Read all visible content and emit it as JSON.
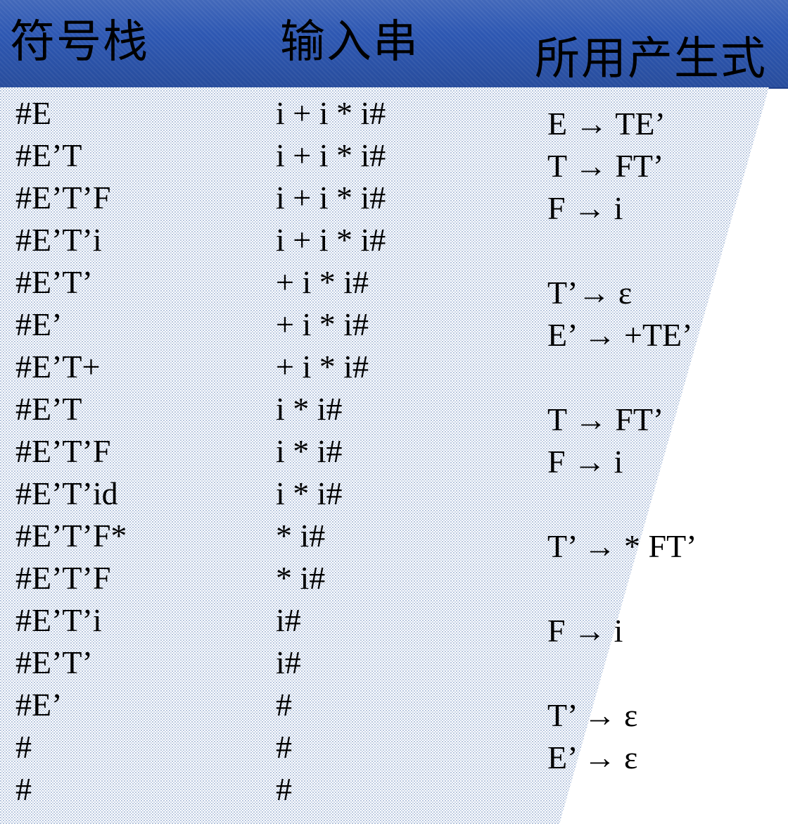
{
  "header": {
    "stack_label": "符号栈",
    "input_label": "输入串",
    "production_label": "所用产生式"
  },
  "rows": [
    {
      "stack": "#E",
      "input": "i + i * i#",
      "production": ""
    },
    {
      "stack": "#E’T",
      "input": "i + i * i#",
      "production": "E → TE’"
    },
    {
      "stack": "#E’T’F",
      "input": "i + i * i#",
      "production": "T → FT’"
    },
    {
      "stack": "#E’T’i",
      "input": "i + i * i#",
      "production": "F → i"
    },
    {
      "stack": "#E’T’",
      "input": "+ i * i#",
      "production": ""
    },
    {
      "stack": "#E’",
      "input": "+ i * i#",
      "production": "T’→ ε"
    },
    {
      "stack": "#E’T+",
      "input": "+ i * i#",
      "production": "E’ → +TE’"
    },
    {
      "stack": "#E’T",
      "input": "i * i#",
      "production": ""
    },
    {
      "stack": "#E’T’F",
      "input": "i * i#",
      "production": "T → FT’"
    },
    {
      "stack": "#E’T’id",
      "input": "i * i#",
      "production": "F → i"
    },
    {
      "stack": "#E’T’F*",
      "input": "* i#",
      "production": ""
    },
    {
      "stack": "#E’T’F",
      "input": "* i#",
      "production": "T’ → * FT’"
    },
    {
      "stack": "#E’T’i",
      "input": "i#",
      "production": ""
    },
    {
      "stack": "#E’T’",
      "input": "i#",
      "production": "F →  i"
    },
    {
      "stack": "#E’",
      "input": "#",
      "production": ""
    },
    {
      "stack": "#",
      "input": "#",
      "production": "T’ → ε"
    },
    {
      "stack": "#",
      "input": "#",
      "production": "E’ → ε"
    }
  ],
  "colors": {
    "header": "#2d57b2",
    "pattern": "#b7c6de",
    "text": "#000000"
  }
}
